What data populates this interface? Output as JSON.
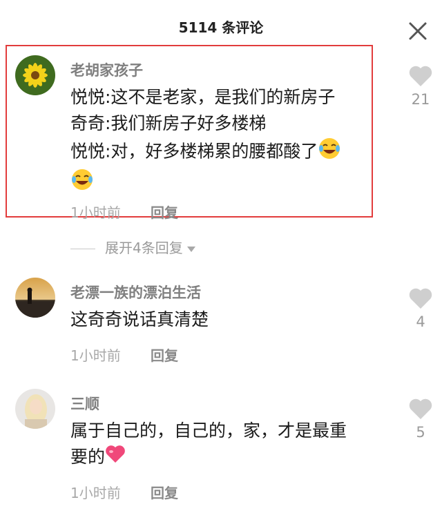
{
  "header": {
    "title": "5114 条评论",
    "close_icon": "close-icon"
  },
  "comments": [
    {
      "username": "老胡家孩子",
      "lines": [
        "悦悦:这不是老家，是我们的新房子",
        "奇奇:我们新房子好多楼梯",
        "悦悦:对，好多楼梯累的腰都酸了"
      ],
      "emoji": "laughing-tears-emoji",
      "time": "1小时前",
      "reply_label": "回复",
      "likes": "21",
      "avatar_icon": "flower-avatar"
    },
    {
      "username": "老漂一族的漂泊生活",
      "lines": [
        "这奇奇说话真清楚"
      ],
      "time": "1小时前",
      "reply_label": "回复",
      "likes": "4",
      "avatar_icon": "sunset-avatar"
    },
    {
      "username": "三顺",
      "lines": [
        "属于自己的，自己的，家，才是最重",
        "要的"
      ],
      "emoji": "heart-emoji",
      "time": "1小时前",
      "reply_label": "回复",
      "likes": "5",
      "avatar_icon": "portrait-avatar"
    }
  ],
  "expand_replies": {
    "label": "展开4条回复"
  },
  "colors": {
    "highlight": "#e23b3b",
    "heart_emoji": "#f0487a",
    "like_icon": "#cfcfcf"
  }
}
